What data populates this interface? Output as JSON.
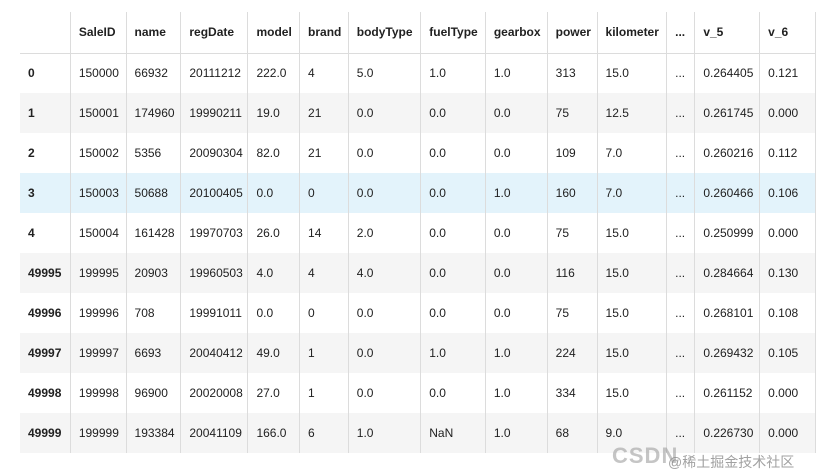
{
  "table": {
    "columns": [
      "",
      "SaleID",
      "name",
      "regDate",
      "model",
      "brand",
      "bodyType",
      "fuelType",
      "gearbox",
      "power",
      "kilometer",
      "...",
      "v_5",
      "v_6"
    ],
    "rows": [
      {
        "index": "0",
        "cells": [
          "150000",
          "66932",
          "20111212",
          "222.0",
          "4",
          "5.0",
          "1.0",
          "1.0",
          "313",
          "15.0",
          "...",
          "0.264405",
          "0.121"
        ]
      },
      {
        "index": "1",
        "cells": [
          "150001",
          "174960",
          "19990211",
          "19.0",
          "21",
          "0.0",
          "0.0",
          "0.0",
          "75",
          "12.5",
          "...",
          "0.261745",
          "0.000"
        ]
      },
      {
        "index": "2",
        "cells": [
          "150002",
          "5356",
          "20090304",
          "82.0",
          "21",
          "0.0",
          "0.0",
          "0.0",
          "109",
          "7.0",
          "...",
          "0.260216",
          "0.112"
        ]
      },
      {
        "index": "3",
        "cells": [
          "150003",
          "50688",
          "20100405",
          "0.0",
          "0",
          "0.0",
          "0.0",
          "1.0",
          "160",
          "7.0",
          "...",
          "0.260466",
          "0.106"
        ]
      },
      {
        "index": "4",
        "cells": [
          "150004",
          "161428",
          "19970703",
          "26.0",
          "14",
          "2.0",
          "0.0",
          "0.0",
          "75",
          "15.0",
          "...",
          "0.250999",
          "0.000"
        ]
      },
      {
        "index": "49995",
        "cells": [
          "199995",
          "20903",
          "19960503",
          "4.0",
          "4",
          "4.0",
          "0.0",
          "0.0",
          "116",
          "15.0",
          "...",
          "0.284664",
          "0.130"
        ]
      },
      {
        "index": "49996",
        "cells": [
          "199996",
          "708",
          "19991011",
          "0.0",
          "0",
          "0.0",
          "0.0",
          "0.0",
          "75",
          "15.0",
          "...",
          "0.268101",
          "0.108"
        ]
      },
      {
        "index": "49997",
        "cells": [
          "199997",
          "6693",
          "20040412",
          "49.0",
          "1",
          "0.0",
          "1.0",
          "1.0",
          "224",
          "15.0",
          "...",
          "0.269432",
          "0.105"
        ]
      },
      {
        "index": "49998",
        "cells": [
          "199998",
          "96900",
          "20020008",
          "27.0",
          "1",
          "0.0",
          "0.0",
          "1.0",
          "334",
          "15.0",
          "...",
          "0.261152",
          "0.000"
        ]
      },
      {
        "index": "49999",
        "cells": [
          "199999",
          "193384",
          "20041109",
          "166.0",
          "6",
          "1.0",
          "NaN",
          "1.0",
          "68",
          "9.0",
          "...",
          "0.226730",
          "0.000"
        ]
      }
    ],
    "highlighted_row": "3"
  },
  "watermark": {
    "logo_text": "CSDN",
    "caption": "@稀土掘金技术社区"
  },
  "colors": {
    "row_stripe": "#f5f5f5",
    "row_highlight": "#e3f3fb",
    "border": "#dcdcdc"
  }
}
